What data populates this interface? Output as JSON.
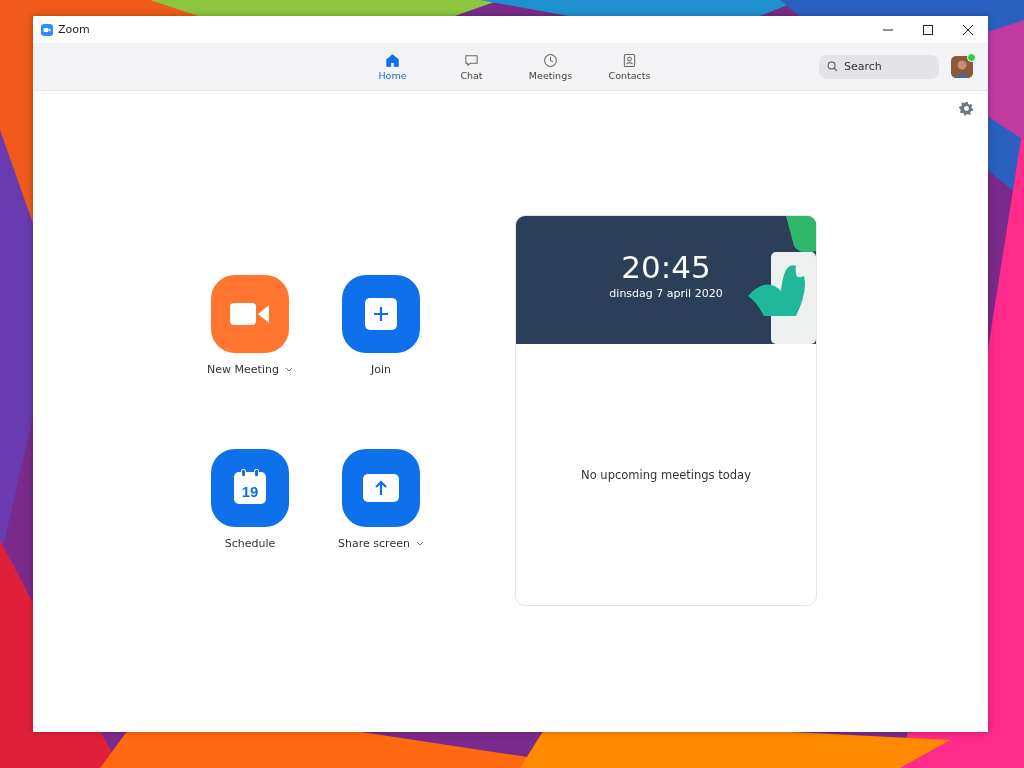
{
  "window": {
    "title": "Zoom"
  },
  "tabs": [
    {
      "label": "Home",
      "kind": "home",
      "selected": true
    },
    {
      "label": "Chat",
      "kind": "chat",
      "selected": false
    },
    {
      "label": "Meetings",
      "kind": "clock",
      "selected": false
    },
    {
      "label": "Contacts",
      "kind": "contacts",
      "selected": false
    }
  ],
  "search": {
    "placeholder": "Search"
  },
  "profile": {
    "online": true
  },
  "actions": [
    {
      "label": "New Meeting",
      "kind": "video",
      "dropdown": true
    },
    {
      "label": "Join",
      "kind": "plus",
      "dropdown": false
    },
    {
      "label": "Schedule",
      "kind": "calendar",
      "dropdown": false,
      "icon_text": "19"
    },
    {
      "label": "Share screen",
      "kind": "upload",
      "dropdown": true
    }
  ],
  "meetings_card": {
    "time": "20:45",
    "date": "dinsdag 7 april 2020",
    "empty_message": "No upcoming meetings today"
  }
}
